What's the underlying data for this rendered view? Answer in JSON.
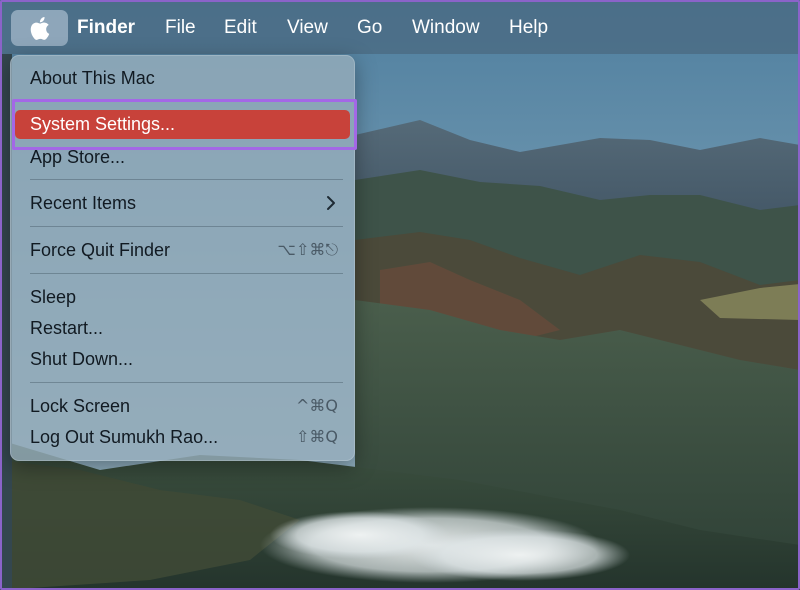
{
  "menubar": {
    "apple_icon": "apple-logo-icon",
    "items": [
      {
        "label": "Finder"
      },
      {
        "label": "File"
      },
      {
        "label": "Edit"
      },
      {
        "label": "View"
      },
      {
        "label": "Go"
      },
      {
        "label": "Window"
      },
      {
        "label": "Help"
      }
    ]
  },
  "apple_menu": {
    "items": [
      {
        "label": "About This Mac",
        "shortcut": ""
      },
      {
        "label": "System Settings...",
        "shortcut": "",
        "highlighted": true
      },
      {
        "label": "App Store...",
        "shortcut": ""
      },
      {
        "label": "Recent Items",
        "shortcut": "",
        "submenu_icon": "chevron-right-icon"
      },
      {
        "label": "Force Quit Finder",
        "shortcut": "⌥⇧⌘⎋"
      },
      {
        "label": "Sleep",
        "shortcut": ""
      },
      {
        "label": "Restart...",
        "shortcut": ""
      },
      {
        "label": "Shut Down...",
        "shortcut": ""
      },
      {
        "label": "Lock Screen",
        "shortcut": "^⌘Q"
      },
      {
        "label": "Log Out Sumukh Rao...",
        "shortcut": "⇧⌘Q"
      }
    ]
  },
  "colors": {
    "highlight": "#c8423a",
    "annotation": "#a368e6",
    "menubar_text": "#ffffff"
  }
}
